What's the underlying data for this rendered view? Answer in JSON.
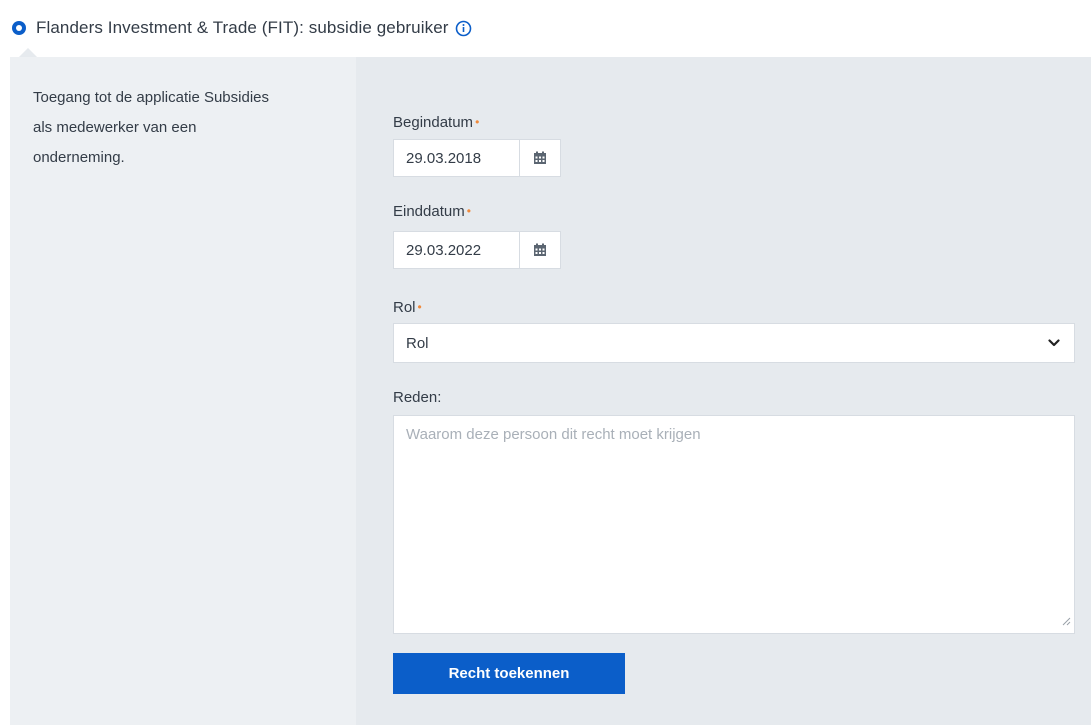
{
  "header": {
    "title": "Flanders Investment & Trade (FIT): subsidie gebruiker",
    "radio_icon": "radio-selected-icon",
    "info_icon": "info-circle-icon",
    "accent_color": "#0b5ec9"
  },
  "description": {
    "line1": "Toegang tot de applicatie Subsidies",
    "line2": "als medewerker van een",
    "line3": "onderneming."
  },
  "form": {
    "begindatum": {
      "label": "Begindatum",
      "required_marker": "•",
      "value": "29.03.2018",
      "icon": "calendar-icon"
    },
    "einddatum": {
      "label": "Einddatum",
      "required_marker": "•",
      "value": "29.03.2022",
      "icon": "calendar-icon"
    },
    "rol": {
      "label": "Rol",
      "required_marker": "•",
      "value": "Rol",
      "icon": "chevron-down-icon"
    },
    "reden": {
      "label": "Reden:",
      "placeholder": "Waarom deze persoon dit recht moet krijgen"
    },
    "submit_label": "Recht toekennen",
    "required_color": "#f08a3c"
  }
}
